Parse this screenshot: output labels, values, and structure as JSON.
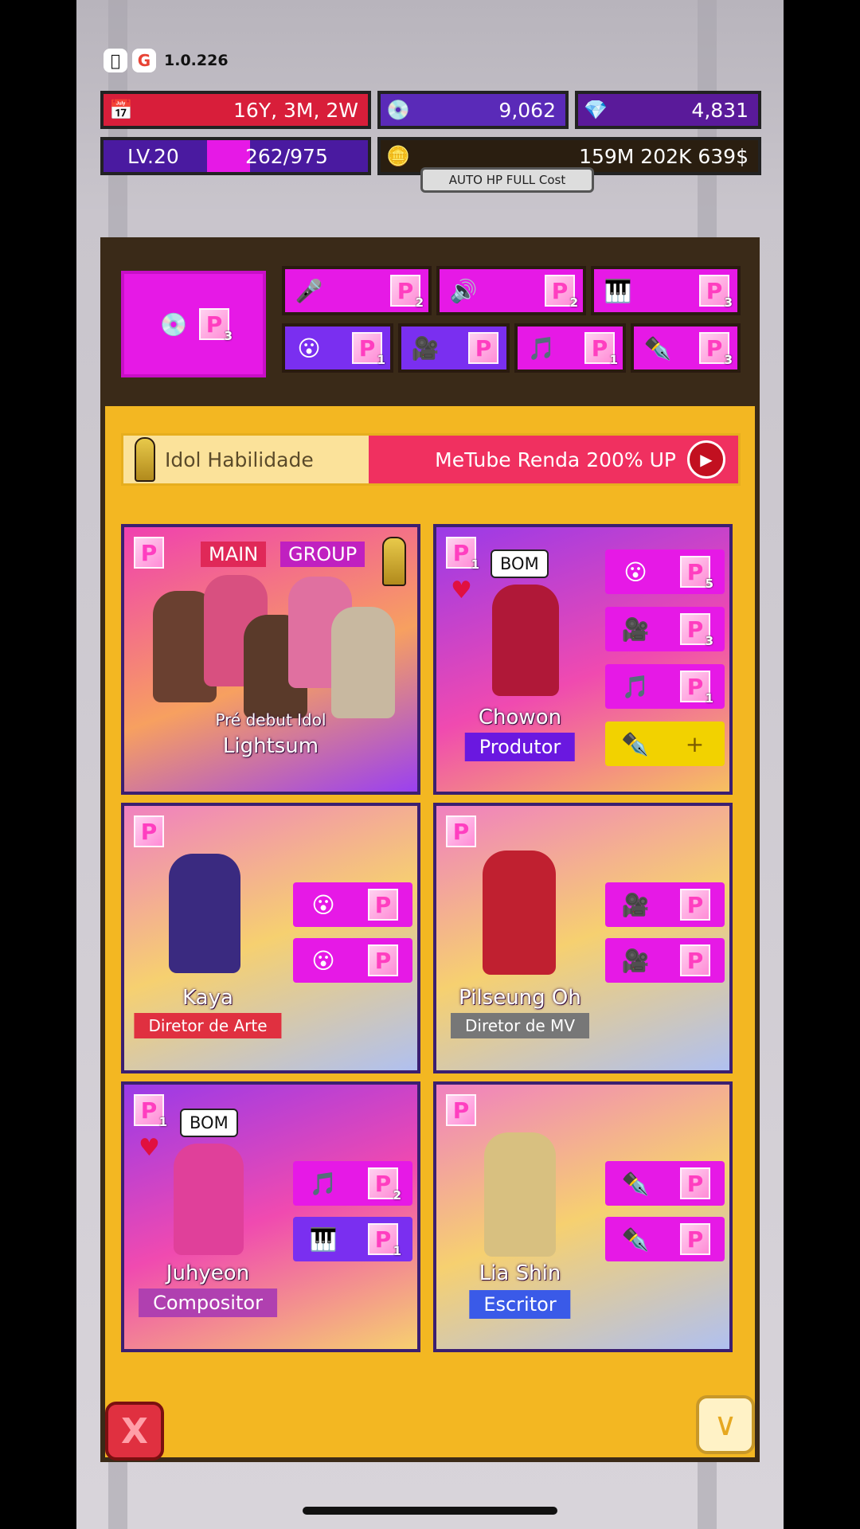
{
  "platform": {
    "apple_icon": "apple-icon",
    "google_icon": "google-icon",
    "google_glyph": "G",
    "version": "1.0.226"
  },
  "stats": {
    "date": "16Y, 3M, 2W",
    "disc_count": "9,062",
    "gem_count": "4,831",
    "level": "LV.20",
    "xp": "262/975",
    "xp_fraction": 0.269,
    "money": "159M 202K 639$",
    "tooltip": "AUTO HP FULL Cost"
  },
  "top_slots": {
    "main": {
      "icon": "disc-icon",
      "count": "3"
    },
    "items": [
      {
        "icon": "microphone-icon",
        "count": "2"
      },
      {
        "icon": "speaker-icon",
        "count": "2"
      },
      {
        "icon": "piano-icon",
        "count": "3"
      },
      {
        "icon": "vocal-face-icon",
        "count": "1"
      },
      {
        "icon": "camera-icon",
        "count": ""
      },
      {
        "icon": "music-note-icon",
        "count": "1"
      },
      {
        "icon": "pen-icon",
        "count": "3"
      }
    ]
  },
  "skill": {
    "label": "Idol Habilidade",
    "promo": "MeTube Renda 200% UP"
  },
  "cards": [
    {
      "name": "Lightsum",
      "sub": "Pré debut Idol",
      "tag_main": "MAIN",
      "tag_group": "GROUP",
      "badge": ""
    },
    {
      "name": "Chowon",
      "role": "Produtor",
      "bubble": "BOM",
      "badge": "1",
      "slots": [
        {
          "icon": "vocal-face-icon",
          "count": "5"
        },
        {
          "icon": "camera-icon",
          "count": "3"
        },
        {
          "icon": "music-note-icon",
          "count": "1"
        },
        {
          "icon": "pen-icon",
          "count": "+"
        }
      ]
    },
    {
      "name": "Kaya",
      "role": "Diretor de Arte",
      "badge": "",
      "slots": [
        {
          "icon": "vocal-face-icon",
          "count": ""
        },
        {
          "icon": "vocal-face-icon",
          "count": ""
        }
      ]
    },
    {
      "name": "Pilseung Oh",
      "role": "Diretor de MV",
      "badge": "",
      "slots": [
        {
          "icon": "camera-icon",
          "count": ""
        },
        {
          "icon": "camera-icon",
          "count": ""
        }
      ]
    },
    {
      "name": "Juhyeon",
      "role": "Compositor",
      "bubble": "BOM",
      "badge": "1",
      "slots": [
        {
          "icon": "music-note-icon",
          "count": "2"
        },
        {
          "icon": "piano-icon",
          "count": "1"
        }
      ]
    },
    {
      "name": "Lia Shin",
      "role": "Escritor",
      "badge": "",
      "slots": [
        {
          "icon": "pen-icon",
          "count": ""
        },
        {
          "icon": "pen-icon",
          "count": ""
        }
      ]
    }
  ],
  "buttons": {
    "close": "X",
    "down": "∨"
  },
  "colors": {
    "panel": "#f3b722",
    "pink_slot": "#e619e6",
    "purple_slot": "#7a2ff0",
    "date_bar": "#d81e3a",
    "money_bar": "#2a1e10"
  }
}
